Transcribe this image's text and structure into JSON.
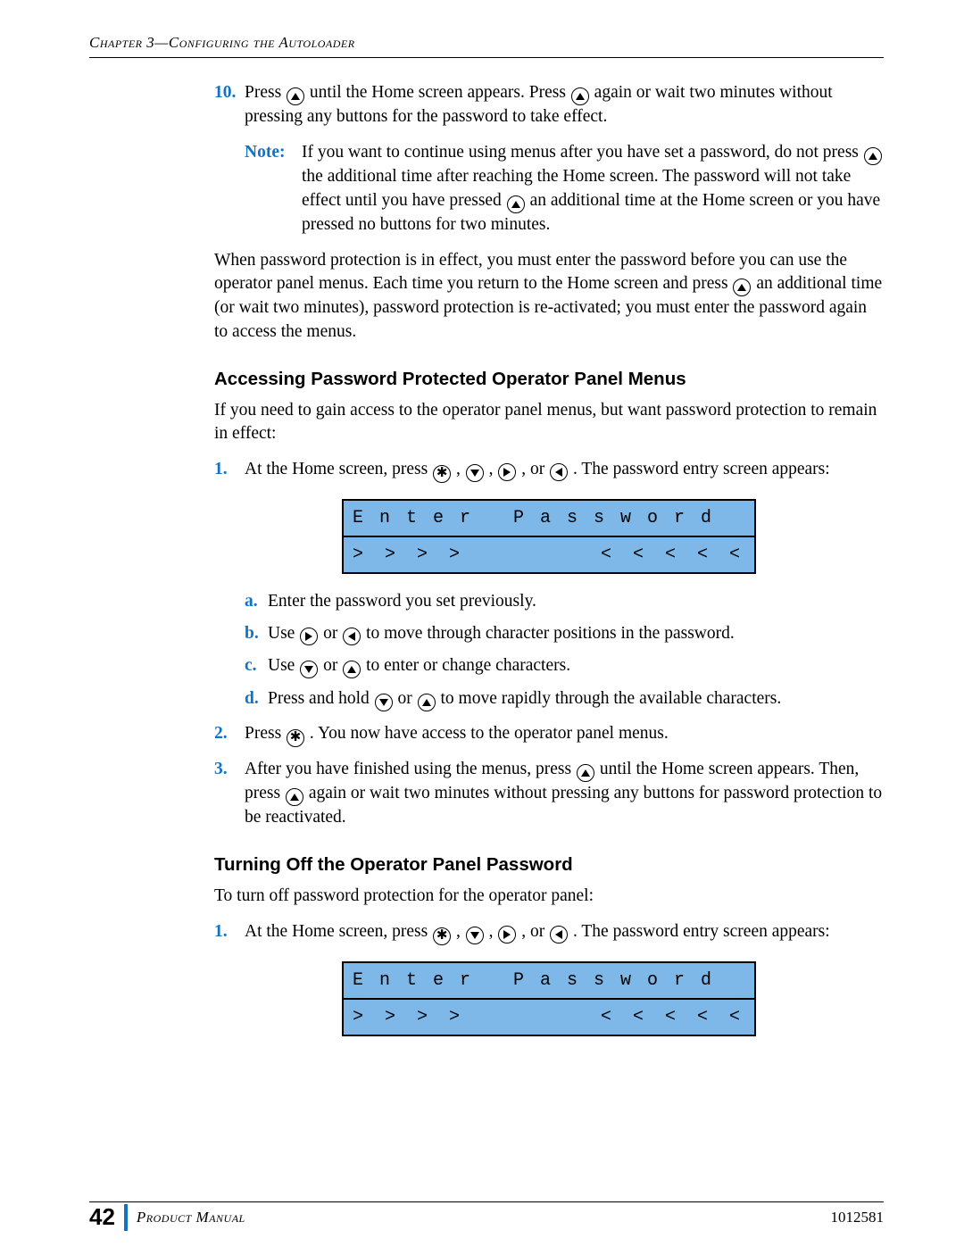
{
  "header": {
    "running": "Chapter 3—Configuring the Autoloader"
  },
  "step10": {
    "num": "10.",
    "text_a": "Press ",
    "text_b": " until the Home screen appears. Press ",
    "text_c": " again or wait two minutes without pressing any buttons for the password to take effect."
  },
  "note": {
    "label": "Note:",
    "a": "If you want to continue using menus after you have set a password, do not press ",
    "b": " the additional time after reaching the Home screen. The password will not take effect until you have pressed ",
    "c": " an additional time at the Home screen or you have pressed no buttons for two minutes."
  },
  "para1": {
    "a": "When password protection is in effect, you must enter the password before you can use the operator panel menus. Each time you return to the Home screen and press ",
    "b": " an additional time (or wait two minutes), password protection is re-activated; you must enter the password again to access the menus."
  },
  "sectionA": "Accessing Password Protected Operator Panel Menus",
  "sectionA_intro": "If you need to gain access to the operator panel menus, but want password protection to remain in effect:",
  "A1": {
    "num": "1.",
    "a": "At the Home screen, press ",
    "sep": ", ",
    "or": ", or ",
    "b": ". The password entry screen appears:"
  },
  "lcd": {
    "line1": "E n t e r   P a s s w o r d",
    "left": "> > > >",
    "right": "< < < < <"
  },
  "subs": {
    "a": {
      "lbl": "a.",
      "text": "Enter the password you set previously."
    },
    "b": {
      "lbl": "b.",
      "pre": "Use ",
      "mid": " or ",
      "post": " to move through character positions in the password."
    },
    "c": {
      "lbl": "c.",
      "pre": "Use ",
      "mid": " or ",
      "post": " to enter or change characters."
    },
    "d": {
      "lbl": "d.",
      "pre": "Press and hold ",
      "mid": " or ",
      "post": " to move rapidly through the available characters."
    }
  },
  "A2": {
    "num": "2.",
    "a": "Press ",
    "b": ". You now have access to the operator panel menus."
  },
  "A3": {
    "num": "3.",
    "a": "After you have finished using the menus, press ",
    "b": " until the Home screen appears. Then, press ",
    "c": " again or wait two minutes without pressing any buttons for password protection to be reactivated."
  },
  "sectionB": "Turning Off the Operator Panel Password",
  "sectionB_intro": "To turn off password protection for the operator panel:",
  "B1": {
    "num": "1.",
    "a": "At the Home screen, press ",
    "sep": ", ",
    "or": ", or ",
    "b": ". The password entry screen appears:"
  },
  "footer": {
    "page": "42",
    "manual": "Product Manual",
    "docnum": "1012581"
  }
}
